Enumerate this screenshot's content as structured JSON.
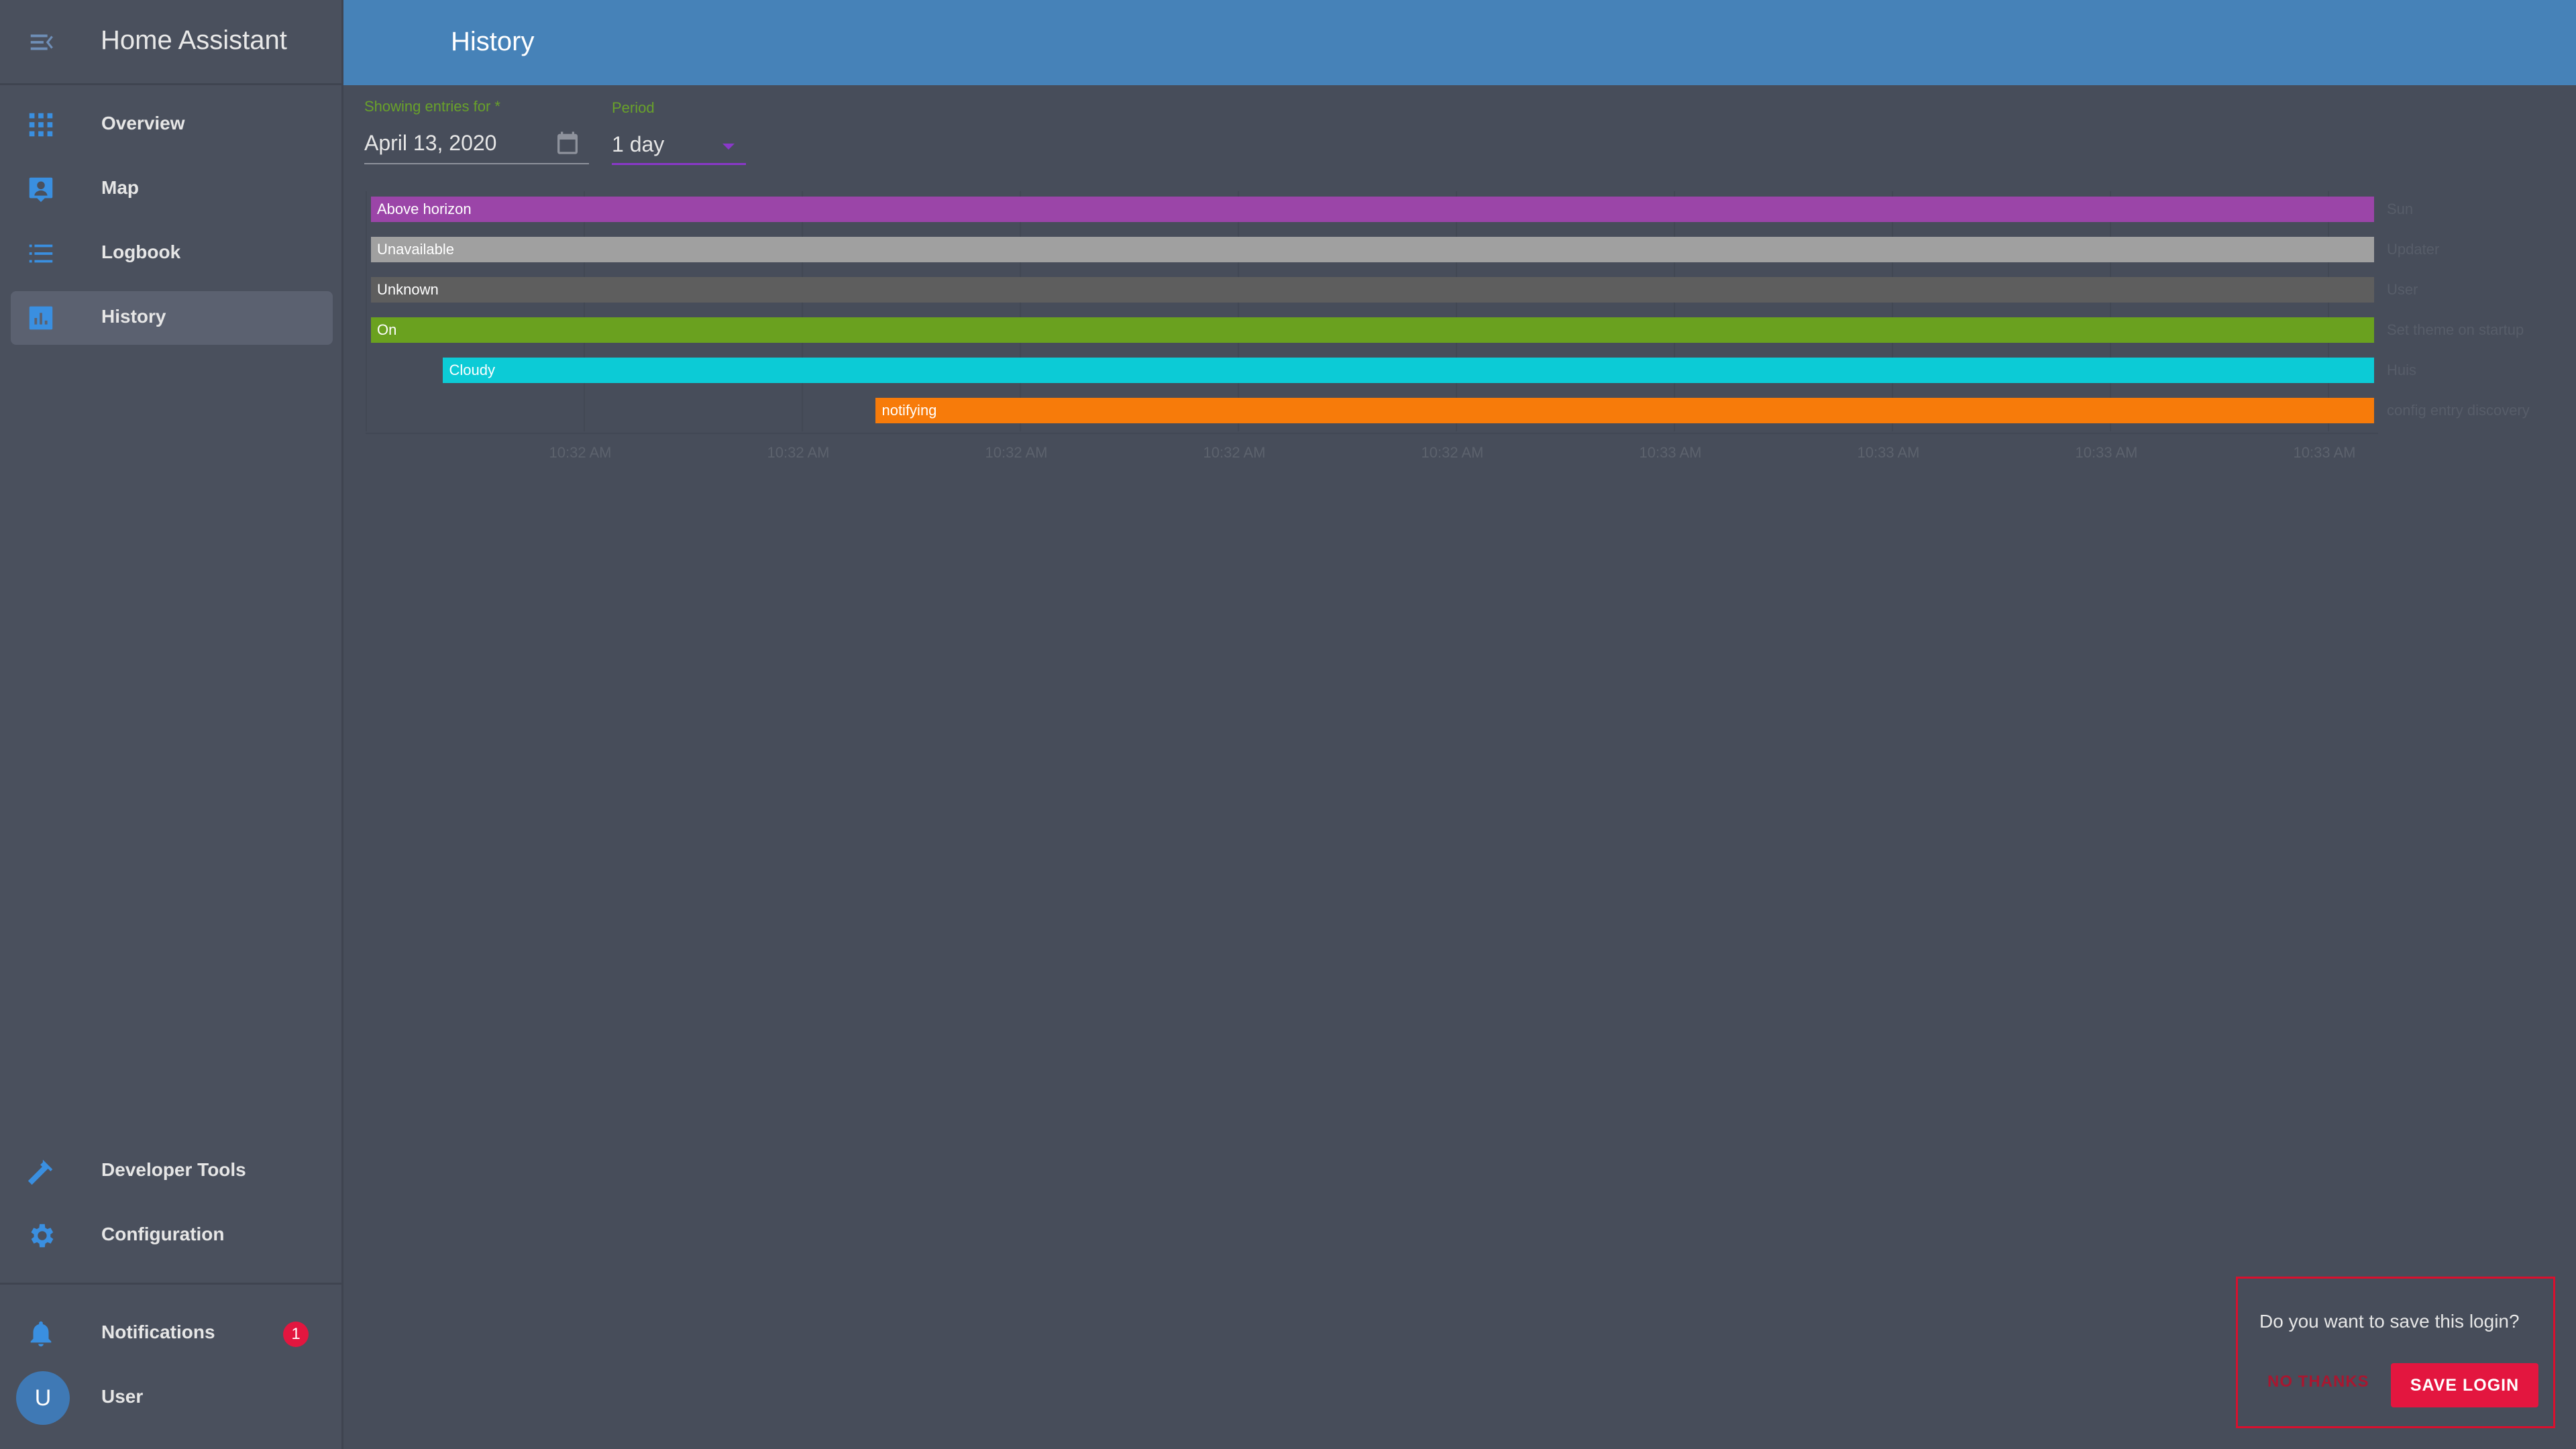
{
  "app": {
    "title": "Home Assistant"
  },
  "sidebar": {
    "items": [
      {
        "label": "Overview",
        "icon": "grid-icon"
      },
      {
        "label": "Map",
        "icon": "map-icon"
      },
      {
        "label": "Logbook",
        "icon": "list-icon"
      },
      {
        "label": "History",
        "icon": "chart-icon",
        "active": true
      },
      {
        "label": "Developer Tools",
        "icon": "hammer-icon"
      },
      {
        "label": "Configuration",
        "icon": "gear-icon"
      }
    ],
    "notifications": {
      "label": "Notifications",
      "count": "1"
    },
    "user": {
      "label": "User",
      "initial": "U"
    }
  },
  "header": {
    "title": "History"
  },
  "filters": {
    "date_label": "Showing entries for *",
    "date_value": "April 13, 2020",
    "period_label": "Period",
    "period_value": "1 day"
  },
  "chart_data": {
    "type": "timeline",
    "rows": [
      {
        "entity": "Sun",
        "state": "Above horizon",
        "color": "#9b45a8",
        "start": 0.0,
        "end": 1.0
      },
      {
        "entity": "Updater",
        "state": "Unavailable",
        "color": "#a0a0a0",
        "start": 0.0,
        "end": 1.0
      },
      {
        "entity": "User",
        "state": "Unknown",
        "color": "#5e5e5e",
        "start": 0.0,
        "end": 1.0
      },
      {
        "entity": "Set theme on startup",
        "state": "On",
        "color": "#6aa11f",
        "start": 0.0,
        "end": 1.0
      },
      {
        "entity": "Huis",
        "state": "Cloudy",
        "color": "#0ccbd6",
        "start": 0.036,
        "end": 1.0
      },
      {
        "entity": "config entry discovery",
        "state": "notifying",
        "color": "#f77b0a",
        "start": 0.252,
        "end": 1.0
      }
    ],
    "x_ticks": [
      "10:32 AM",
      "10:32 AM",
      "10:32 AM",
      "10:32 AM",
      "10:32 AM",
      "10:33 AM",
      "10:33 AM",
      "10:33 AM",
      "10:33 AM"
    ]
  },
  "dialog": {
    "question": "Do you want to save this login?",
    "no_label": "NO THANKS",
    "save_label": "SAVE LOGIN"
  },
  "colors": {
    "accent": "#4682b8",
    "primary_button": "#e3163f",
    "field_label": "#69a22a",
    "period_underline": "#8a38c9"
  }
}
